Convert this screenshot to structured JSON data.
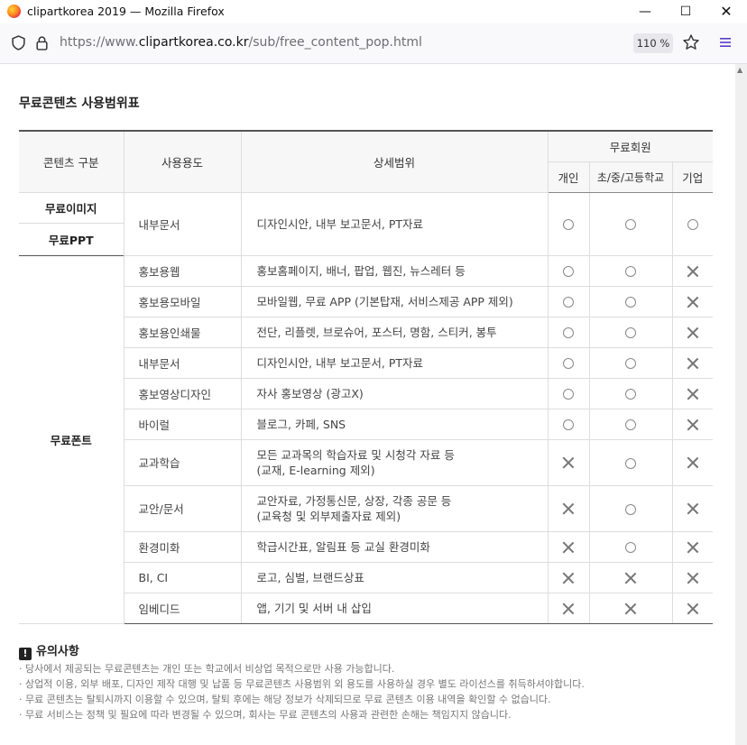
{
  "browser": {
    "window_title": "clipartkorea 2019 — Mozilla Firefox",
    "url_prefix": "https://www.",
    "url_domain": "clipartkorea.co.kr",
    "url_path": "/sub/free_content_pop.html",
    "zoom": "110 %",
    "icons": [
      "firefox-icon",
      "shield-icon",
      "lock-icon",
      "star-icon",
      "menu-icon",
      "minimize-icon",
      "maximize-icon",
      "close-icon"
    ]
  },
  "page": {
    "title": "무료콘텐츠 사용범위표",
    "headers": {
      "category": "콘텐츠 구분",
      "usage": "사용용도",
      "detail": "상세범위",
      "member_group": "무료회원",
      "personal": "개인",
      "school": "초/중/고등학교",
      "company": "기업"
    },
    "categories": {
      "image": "무료이미지",
      "ppt": "무료PPT",
      "font": "무료폰트"
    },
    "shared_row": {
      "usage": "내부문서",
      "detail": "디자인시안, 내부 보고문서, PT자료",
      "marks": [
        "O",
        "O",
        "O"
      ]
    },
    "font_rows": [
      {
        "usage": "홍보용웹",
        "detail": "홍보홈페이지, 배너, 팝업, 웹진, 뉴스레터 등",
        "marks": [
          "O",
          "O",
          "X"
        ]
      },
      {
        "usage": "홍보용모바일",
        "detail": "모바일웹, 무료 APP (기본탑재, 서비스제공 APP 제외)",
        "marks": [
          "O",
          "O",
          "X"
        ]
      },
      {
        "usage": "홍보용인쇄물",
        "detail": "전단, 리플렛, 브로슈어, 포스터, 명함, 스티커, 봉투",
        "marks": [
          "O",
          "O",
          "X"
        ]
      },
      {
        "usage": "내부문서",
        "detail": "디자인시안, 내부 보고문서, PT자료",
        "marks": [
          "O",
          "O",
          "X"
        ]
      },
      {
        "usage": "홍보영상디자인",
        "detail": "자사 홍보영상 (광고X)",
        "marks": [
          "O",
          "O",
          "X"
        ]
      },
      {
        "usage": "바이럴",
        "detail": "블로그, 카페, SNS",
        "marks": [
          "O",
          "O",
          "X"
        ]
      },
      {
        "usage": "교과학습",
        "detail": "모든 교과목의 학습자료 및 시청각 자료 등",
        "detail2": "(교재, E-learning 제외)",
        "marks": [
          "X",
          "O",
          "X"
        ]
      },
      {
        "usage": "교안/문서",
        "detail": "교안자료, 가정통신문, 상장, 각종 공문 등",
        "detail2": "(교육청 및 외부제출자료 제외)",
        "marks": [
          "X",
          "O",
          "X"
        ]
      },
      {
        "usage": "환경미화",
        "detail": "학급시간표, 알림표 등 교실 환경미화",
        "marks": [
          "X",
          "O",
          "X"
        ]
      },
      {
        "usage": "BI, CI",
        "detail": "로고, 심벌, 브랜드상표",
        "marks": [
          "X",
          "X",
          "X"
        ]
      },
      {
        "usage": "임베디드",
        "detail": "앱, 기기 및 서버 내 삽입",
        "marks": [
          "X",
          "X",
          "X"
        ]
      }
    ],
    "notice": {
      "title": "유의사항",
      "items": [
        "당사에서 제공되는 무료콘텐츠는 개인 또는 학교에서 비상업 목적으로만 사용 가능합니다.",
        "상업적 이용, 외부 배포, 디자인 제작 대행 및 납품 등 무료콘텐츠 사용범위 외 용도를 사용하실 경우 별도 라이선스를 취득하셔야합니다.",
        "무료 콘텐츠는 탈퇴시까지 이용할 수 있으며, 탈퇴 후에는 해당 정보가 삭제되므로 무료 콘텐츠 이용 내역을 확인할 수 없습니다.",
        "무료 서비스는 정책 및 필요에 따라 변경될 수 있으며, 회사는 무료 콘텐츠의 사용과 관련한 손해는 책임지지 않습니다."
      ]
    }
  }
}
